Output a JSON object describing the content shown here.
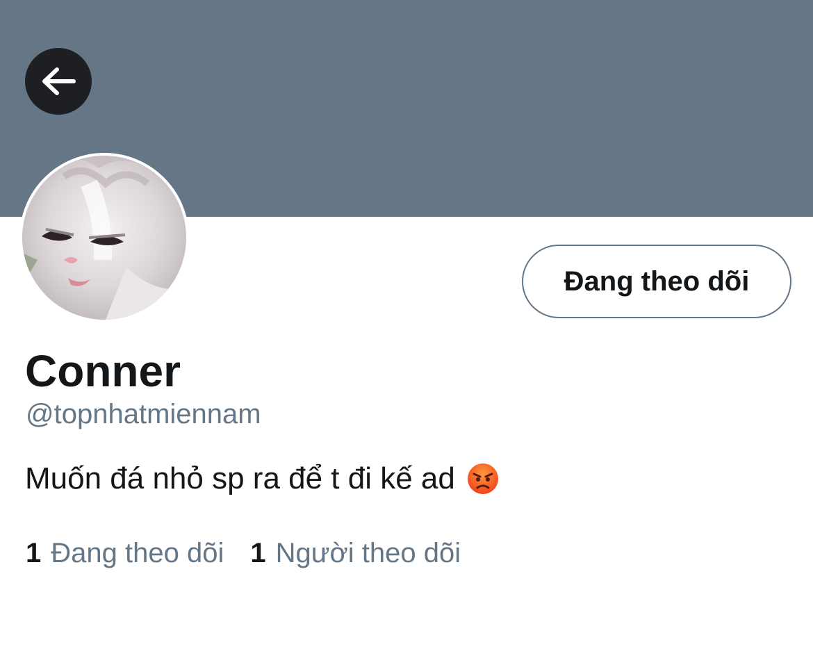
{
  "profile": {
    "display_name": "Conner",
    "handle": "@topnhatmiennam",
    "bio_text": "Muốn đá nhỏ sp ra để t đi kế ad",
    "bio_emoji": "pouting-face-emoji",
    "avatar": "white-cat-grumpy-face"
  },
  "header": {
    "back_icon": "arrow-left-icon"
  },
  "actions": {
    "follow_button_label": "Đang theo dõi"
  },
  "stats": {
    "following_count": "1",
    "following_label": "Đang theo dõi",
    "followers_count": "1",
    "followers_label": "Người theo dõi"
  },
  "colors": {
    "banner": "#657786",
    "primary_text": "#14171a",
    "secondary_text": "#657786",
    "back_button_bg": "#1d1f22"
  }
}
